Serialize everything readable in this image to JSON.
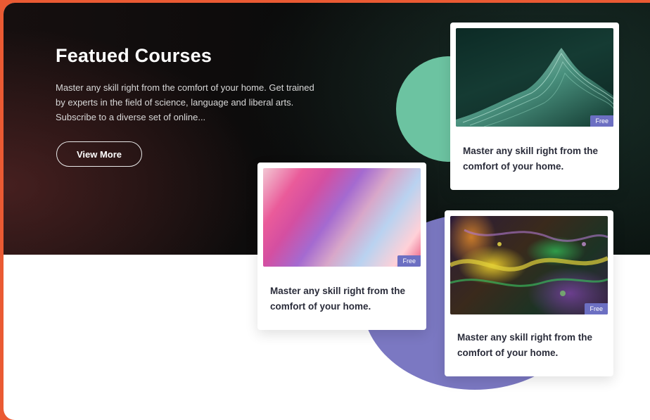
{
  "hero": {
    "title": "Featued Courses",
    "description": "Master any skill right from the comfort of your home. Get trained by experts in the field of science, language and liberal arts. Subscribe to a diverse set of online...",
    "button_label": "View More"
  },
  "colors": {
    "frame_border": "#ea5a33",
    "hero_background": "#0b0b0b",
    "accent_green": "#6cc3a1",
    "accent_purple": "#7b78c2",
    "badge": "#6c6fc2"
  },
  "cards": [
    {
      "badge": "Free",
      "text": "Master any skill right from the comfort of your home.",
      "image": "teal-mountain-image"
    },
    {
      "badge": "Free",
      "text": "Master any skill right from the comfort of your home.",
      "image": "pink-gradient-image"
    },
    {
      "badge": "Free",
      "text": "Master any skill right from the comfort of your home.",
      "image": "fluid-art-image"
    }
  ]
}
